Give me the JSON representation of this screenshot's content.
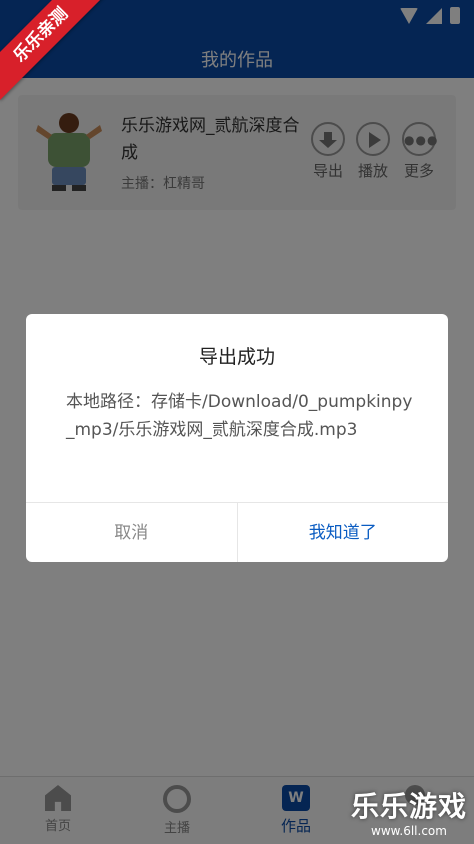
{
  "header": {
    "title": "我的作品"
  },
  "ribbon": {
    "text": "乐乐亲测"
  },
  "work": {
    "title": "乐乐游戏网_贰航深度合成",
    "host": "主播：杠精哥",
    "actions": [
      {
        "label": "导出",
        "icon": "download-icon"
      },
      {
        "label": "播放",
        "icon": "play-icon"
      },
      {
        "label": "更多",
        "icon": "more-icon"
      }
    ]
  },
  "dialog": {
    "title": "导出成功",
    "message": "本地路径：存储卡/Download/0_pumpkinpy_mp3/乐乐游戏网_贰航深度合成.mp3",
    "cancel_label": "取消",
    "ok_label": "我知道了"
  },
  "tabs": [
    {
      "label": "首页",
      "icon": "home-icon"
    },
    {
      "label": "主播",
      "icon": "host-icon"
    },
    {
      "label": "作品",
      "icon": "works-icon",
      "active": true
    }
  ],
  "watermark": {
    "main": "乐乐游戏",
    "sub": "www.6ll.com"
  },
  "colors": {
    "brand": "#0a4aa6",
    "accent_button": "#0a5cc2",
    "ribbon": "#d8202a"
  }
}
